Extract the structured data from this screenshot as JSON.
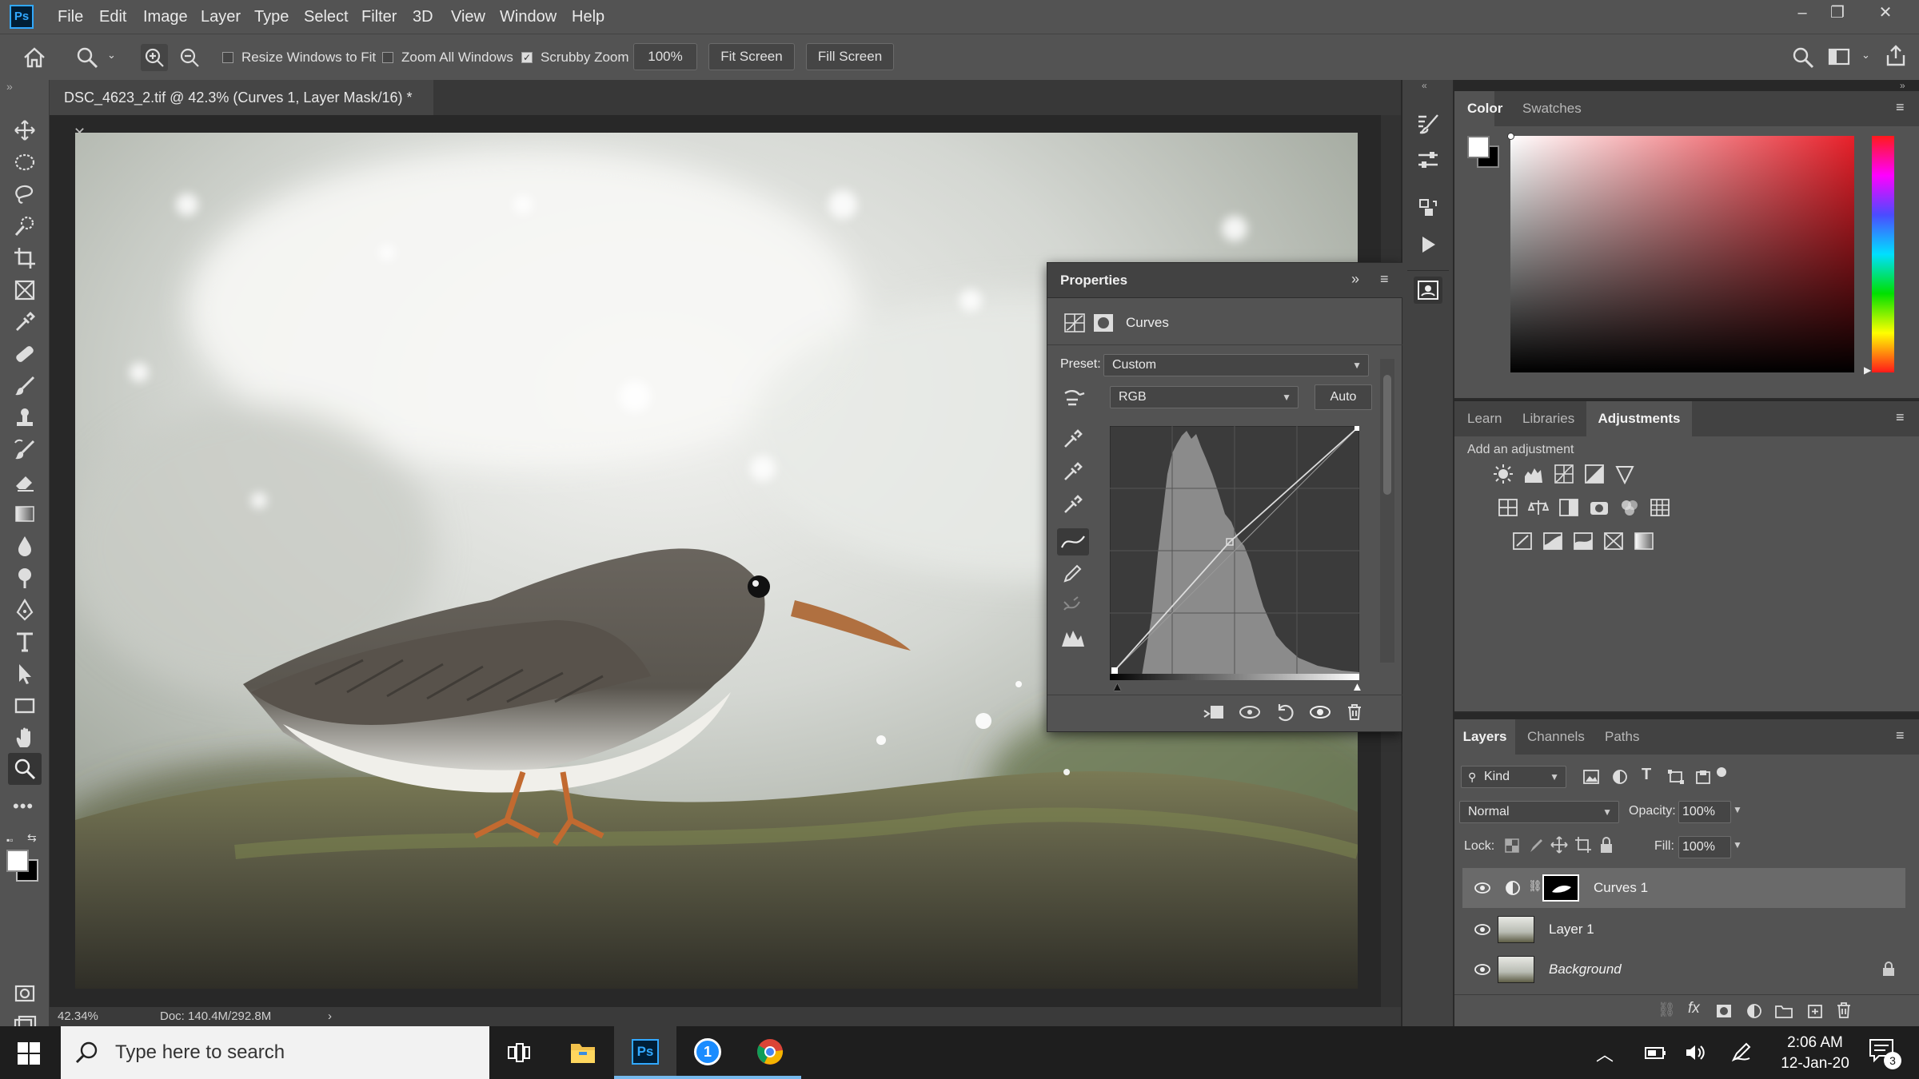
{
  "app": {
    "logo": "Ps"
  },
  "menu": [
    "File",
    "Edit",
    "Image",
    "Layer",
    "Type",
    "Select",
    "Filter",
    "3D",
    "View",
    "Window",
    "Help"
  ],
  "options": {
    "resize_windows": "Resize Windows to Fit",
    "zoom_all": "Zoom All Windows",
    "scrubby_zoom": "Scrubby Zoom",
    "zoom_value": "100%",
    "fit_screen": "Fit Screen",
    "fill_screen": "Fill Screen"
  },
  "document": {
    "tab_title": "DSC_4623_2.tif @ 42.3% (Curves 1, Layer Mask/16) *",
    "zoom": "42.34%",
    "doc_info": "Doc: 140.4M/292.8M"
  },
  "properties": {
    "title": "Properties",
    "adjustment_name": "Curves",
    "preset_label": "Preset:",
    "preset_value": "Custom",
    "channel_value": "RGB",
    "auto_label": "Auto"
  },
  "color_panel": {
    "tabs": [
      "Color",
      "Swatches"
    ]
  },
  "adjustments_panel": {
    "tabs": [
      "Learn",
      "Libraries",
      "Adjustments"
    ],
    "hint": "Add an adjustment"
  },
  "layers_panel": {
    "tabs": [
      "Layers",
      "Channels",
      "Paths"
    ],
    "kind_filter": "Kind",
    "blend_mode": "Normal",
    "opacity_label": "Opacity:",
    "opacity_value": "100%",
    "lock_label": "Lock:",
    "fill_label": "Fill:",
    "fill_value": "100%",
    "layers": [
      {
        "name": "Curves 1",
        "selected": true
      },
      {
        "name": "Layer 1",
        "selected": false
      },
      {
        "name": "Background",
        "selected": false,
        "locked": true
      }
    ]
  },
  "taskbar": {
    "search_placeholder": "Type here to search",
    "time": "2:06 AM",
    "date": "12-Jan-20",
    "notification_count": "3"
  },
  "colors": {
    "accent": "#31a8ff",
    "panel": "#535353",
    "canvas": "#282828"
  }
}
